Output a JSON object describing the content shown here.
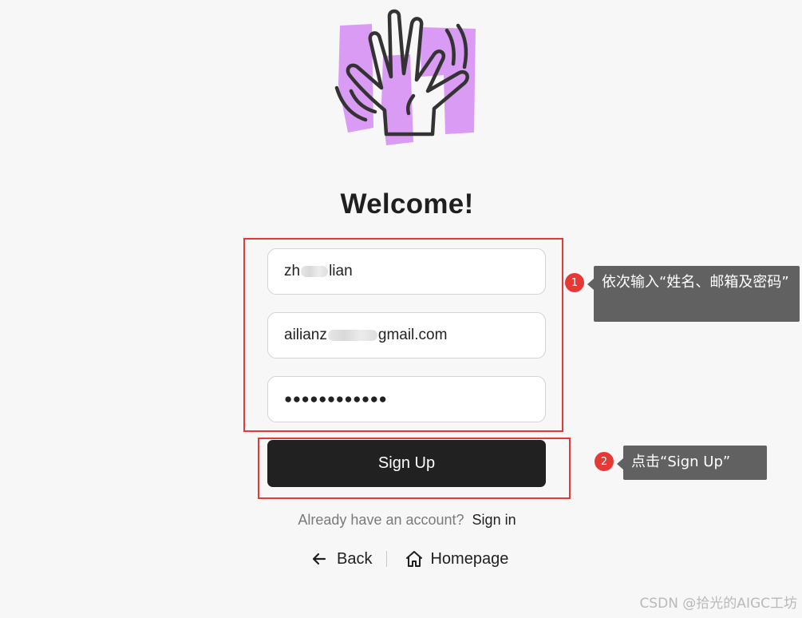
{
  "page": {
    "title": "Welcome!"
  },
  "form": {
    "name_visible_start": "zh",
    "name_visible_end": "lian",
    "email_visible_start": "ailianz",
    "email_visible_end": "gmail.com",
    "password_masked": "●●●●●●●●●●●●",
    "signup_label": "Sign Up"
  },
  "account": {
    "prompt": "Already have an account?",
    "signin_label": "Sign in"
  },
  "nav": {
    "back_label": "Back",
    "back_icon": "arrow-left-icon",
    "homepage_label": "Homepage",
    "homepage_icon": "home-icon"
  },
  "annotations": [
    {
      "number": "1",
      "text": "依次输入“姓名、邮箱及密码”"
    },
    {
      "number": "2",
      "text": "点击“Sign Up”"
    }
  ],
  "watermark": "CSDN @拾光的AIGC工坊",
  "colors": {
    "logo_accent": "#d99bf3",
    "button_bg": "#212121",
    "annotation_red": "#e53935",
    "callout_bg": "#616161"
  }
}
